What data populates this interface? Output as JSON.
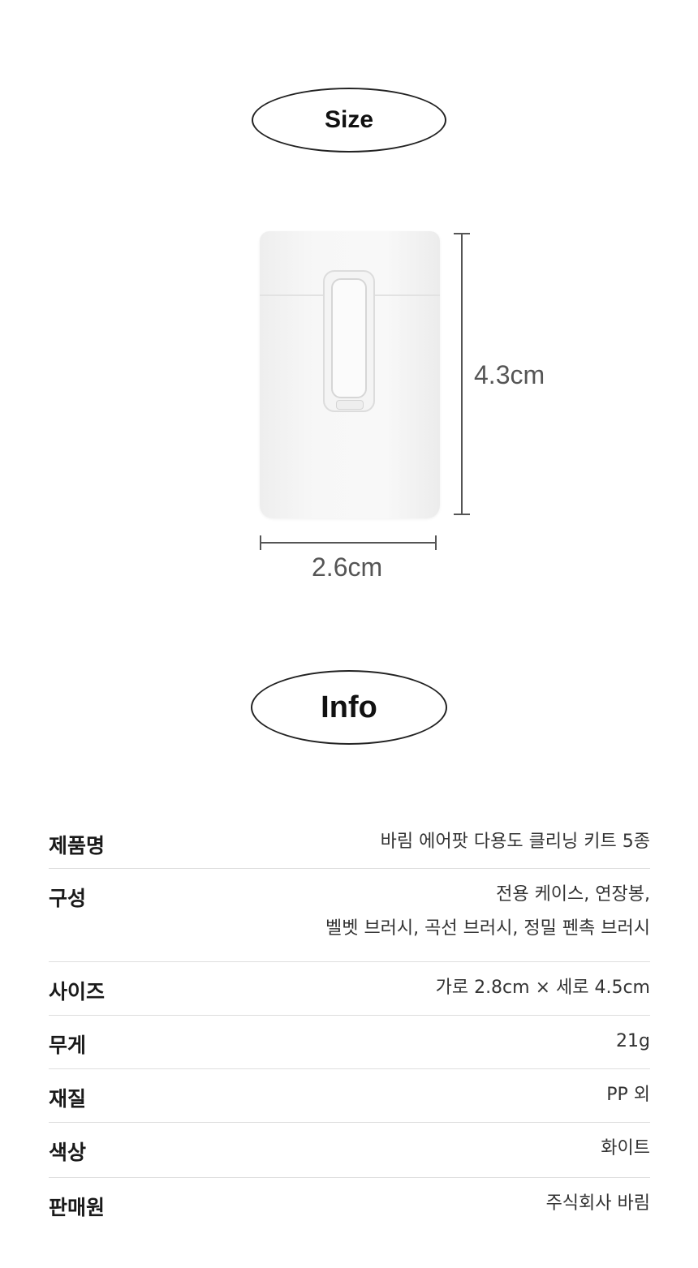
{
  "size_section": {
    "title": "Size"
  },
  "dimensions": {
    "height": "4.3cm",
    "width": "2.6cm"
  },
  "info_section": {
    "title": "Info"
  },
  "specs": [
    {
      "key": "제품명",
      "lines": [
        "바림 에어팟 다용도 클리닝 키트 5종"
      ]
    },
    {
      "key": "구성",
      "lines": [
        "전용 케이스, 연장봉,",
        "벨벳 브러시, 곡선 브러시, 정밀 펜촉  브러시"
      ]
    },
    {
      "key": "사이즈",
      "lines": [
        "가로 2.8cm × 세로 4.5cm"
      ]
    },
    {
      "key": "무게",
      "lines": [
        "21g"
      ]
    },
    {
      "key": "재질",
      "lines": [
        "PP 외"
      ]
    },
    {
      "key": "색상",
      "lines": [
        "화이트"
      ]
    },
    {
      "key": "판매원",
      "lines": [
        "주식회사 바림"
      ]
    }
  ]
}
